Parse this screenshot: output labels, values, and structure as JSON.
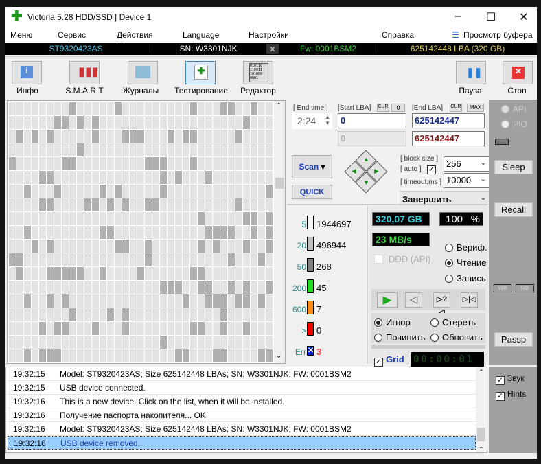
{
  "window": {
    "title": "Victoria 5.28 HDD/SSD | Device 1",
    "minimize": "–",
    "maximize": "☐",
    "close": "✕"
  },
  "menu": {
    "items": [
      "Меню",
      "Сервис",
      "Действия",
      "Language",
      "Настройки",
      "Справка"
    ],
    "buffer": "Просмотр буфера"
  },
  "device": {
    "model": "ST9320423AS",
    "sn": "SN: W3301NJK",
    "x": "x",
    "fw": "Fw: 0001BSM2",
    "lba": "625142448 LBA (320 GB)"
  },
  "toolbar": {
    "info": "Инфо",
    "smart": "S.M.A.R.T",
    "logs": "Журналы",
    "test": "Тестирование",
    "editor": "Редактор",
    "pause": "Пауза",
    "stop": "Стоп",
    "editor_icon_text": "010110 110011 101000 0001"
  },
  "controls": {
    "end_time_label": "[ End time ]",
    "end_time": "2:24",
    "start_lba_label": "[Start LBA]",
    "cur": "CUR",
    "zero": "0",
    "start_lba": "0",
    "start_lba_cur": "0",
    "end_lba_label": "[End LBA]",
    "max": "MAX",
    "end_lba": "625142447",
    "end_lba_cur": "625142447",
    "scan": "Scan",
    "quick": "QUICK",
    "block_size_label": "[ block size ]",
    "auto_label": "[ auto ]",
    "timeout_label": "[ timeout,ms ]",
    "block_size": "256",
    "timeout": "10000",
    "action": "Завершить"
  },
  "legend": [
    {
      "label": "5",
      "count": "1944697",
      "color": "#f4f4f4"
    },
    {
      "label": "20",
      "count": "496944",
      "color": "#c0c0c0"
    },
    {
      "label": "50",
      "count": "268",
      "color": "#808080"
    },
    {
      "label": "200",
      "count": "45",
      "color": "#22dd22"
    },
    {
      "label": "600",
      "count": "7",
      "color": "#ff8c1a"
    },
    {
      "label": ">",
      "count": "0",
      "color": "#ee0000"
    },
    {
      "label": "Err",
      "count": "3",
      "color": "#0022cc"
    }
  ],
  "stats": {
    "size": "320,07 GB",
    "percent": "100",
    "percent_sign": "%",
    "speed": "23 MB/s",
    "ddd": "DDD (API)",
    "verify": "Вериф.",
    "read": "Чтение",
    "write": "Запись",
    "mode_selected": "Чтение",
    "ignore": "Игнор",
    "erase": "Стереть",
    "repair": "Починить",
    "refresh": "Обновить",
    "error_selected": "Игнор",
    "grid": "Grid",
    "grid_checked": true,
    "timer": "00:00:01",
    "progress_percent": 100
  },
  "right": {
    "api": "API",
    "pio": "PIO",
    "sleep": "Sleep",
    "recall": "Recall",
    "wr": "WR",
    "rd": "RD",
    "passp": "Passp",
    "sound": "Звук",
    "hints": "Hints"
  },
  "log": [
    {
      "time": "19:32:15",
      "msg": "Model: ST9320423AS; Size 625142448 LBAs; SN: W3301NJK; FW: 0001BSM2"
    },
    {
      "time": "19:32:15",
      "msg": "USB device connected."
    },
    {
      "time": "19:32:16",
      "msg": "This is a new device. Click on the list, when it will be installed."
    },
    {
      "time": "19:32:16",
      "msg": "Получение паспорта накопителя... OK"
    },
    {
      "time": "19:32:16",
      "msg": "Model: ST9320423AS; Size 625142448 LBAs; SN: W3301NJK; FW: 0001BSM2"
    },
    {
      "time": "19:32:16",
      "msg": "USB device removed."
    }
  ],
  "colors": {
    "accent_blue": "#1a3fb0",
    "selected_row": "#99ccff",
    "panel_grey": "#a0a0a0"
  }
}
